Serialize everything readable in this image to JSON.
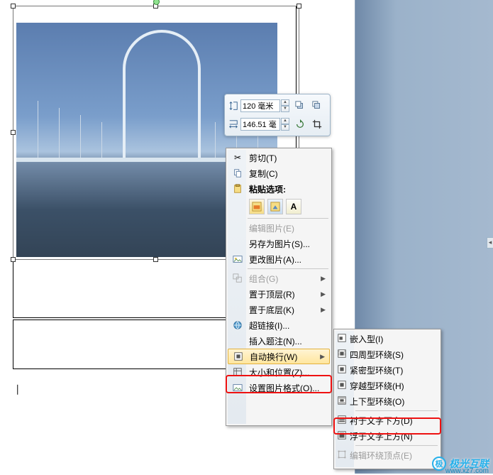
{
  "size_tool": {
    "height_value": "120 毫米",
    "width_value": "146.51 毫"
  },
  "context_menu": {
    "cut": "剪切(T)",
    "copy": "复制(C)",
    "paste_header": "粘贴选项:",
    "edit_picture": "编辑图片(E)",
    "save_as_picture": "另存为图片(S)...",
    "change_picture": "更改图片(A)...",
    "group": "组合(G)",
    "bring_front": "置于顶层(R)",
    "send_back": "置于底层(K)",
    "hyperlink": "超链接(I)...",
    "insert_caption": "插入题注(N)...",
    "wrap_text": "自动换行(W)",
    "size_position": "大小和位置(Z)...",
    "format_picture": "设置图片格式(O)..."
  },
  "wrap_submenu": {
    "inline": "嵌入型(I)",
    "square": "四周型环绕(S)",
    "tight": "紧密型环绕(T)",
    "through": "穿越型环绕(H)",
    "top_bottom": "上下型环绕(O)",
    "behind": "衬于文字下方(D)",
    "front": "浮于文字上方(N)",
    "edit_points": "编辑环绕顶点(E)"
  },
  "watermark": {
    "brand": "极光互联",
    "url": "www.xz7.com"
  }
}
